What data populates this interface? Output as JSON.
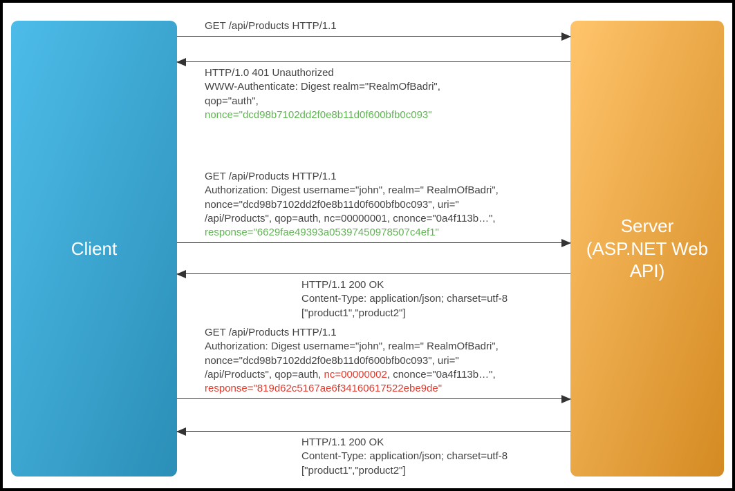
{
  "participants": {
    "client": "Client",
    "server_line1": "Server",
    "server_line2": "(ASP.NET Web",
    "server_line3": "API)"
  },
  "m1": {
    "line1": "GET /api/Products HTTP/1.1"
  },
  "m2": {
    "line1": "HTTP/1.0 401 Unauthorized",
    "line2": "WWW-Authenticate: Digest realm=\"RealmOfBadri\",",
    "line3": "qop=\"auth\",",
    "line4": "nonce=\"dcd98b7102dd2f0e8b11d0f600bfb0c093\""
  },
  "m3": {
    "line1": "GET /api/Products HTTP/1.1",
    "line2": "Authorization: Digest username=\"john\", realm=\" RealmOfBadri\",",
    "line3": "nonce=\"dcd98b7102dd2f0e8b11d0f600bfb0c093\", uri=\"",
    "line4": "/api/Products\", qop=auth, nc=00000001, cnonce=\"0a4f113b…\",",
    "line5": "response=\"6629fae49393a05397450978507c4ef1\""
  },
  "m4": {
    "line1": "HTTP/1.1 200 OK",
    "line2": "Content-Type: application/json;  charset=utf-8",
    "line3": "[\"product1\",\"product2\"]"
  },
  "m5": {
    "line1": "GET /api/Products HTTP/1.1",
    "line2": "Authorization: Digest username=\"john\", realm=\" RealmOfBadri\",",
    "line3": "nonce=\"dcd98b7102dd2f0e8b11d0f600bfb0c093\", uri=\"",
    "line4a": "/api/Products\", qop=auth, ",
    "line4b": "nc=00000002",
    "line4c": ", cnonce=\"0a4f113b…\",",
    "line5": "response=\"819d62c5167ae6f34160617522ebe9de\""
  },
  "m6": {
    "line1": "HTTP/1.1 200 OK",
    "line2": "Content-Type: application/json;  charset=utf-8",
    "line3": "[\"product1\",\"product2\"]"
  }
}
